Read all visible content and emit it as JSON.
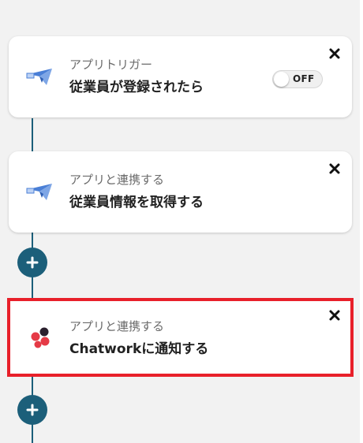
{
  "flow": {
    "steps": [
      {
        "label": "アプリトリガー",
        "title": "従業員が登録されたら",
        "icon": "paper-plane-icon",
        "toggle_label": "OFF",
        "toggle_on": false
      },
      {
        "label": "アプリと連携する",
        "title": "従業員情報を取得する",
        "icon": "paper-plane-icon"
      },
      {
        "label": "アプリと連携する",
        "title": "Chatworkに通知する",
        "icon": "chatwork-icon",
        "highlighted": true
      }
    ]
  },
  "colors": {
    "accent": "#1c5f7a",
    "highlight_border": "#e8202a",
    "panel_background": "#f2f2f2",
    "chatwork_red": "#e53a46",
    "chatwork_dark": "#2a1f2d",
    "plane_blue": "#4a7fd6"
  }
}
